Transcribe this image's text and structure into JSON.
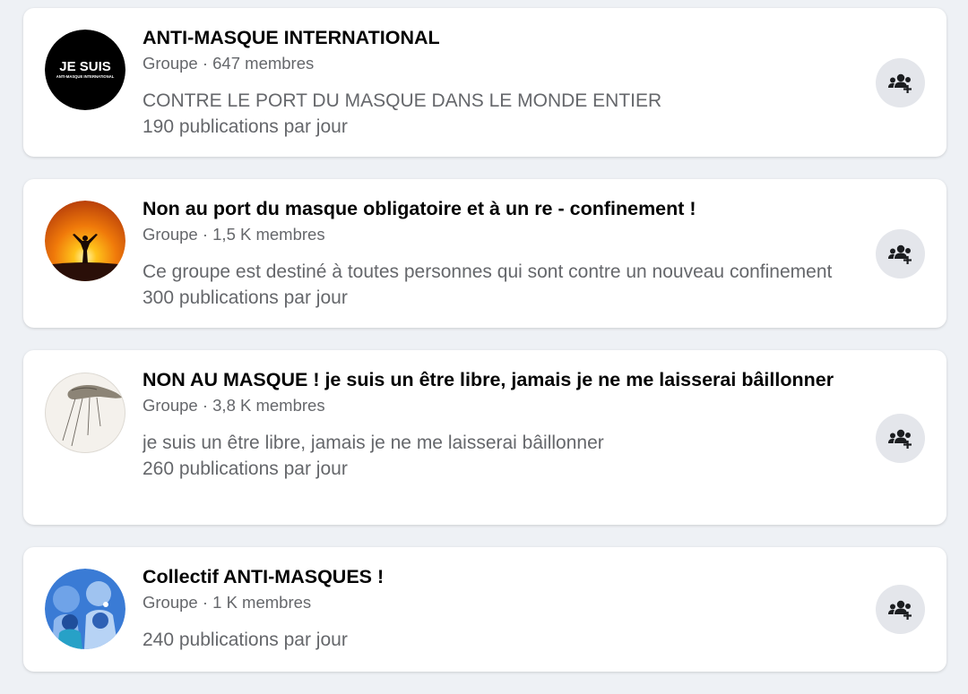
{
  "groups": [
    {
      "name": "ANTI-MASQUE INTERNATIONAL",
      "meta": "Groupe · 647 membres",
      "description": "CONTRE LE PORT DU MASQUE DANS LE MONDE ENTIER",
      "posts": "190 publications par jour",
      "avatar_icon": "je-suis-logo",
      "avatar_text_main": "JE SUIS",
      "avatar_text_sub": "ANTI-MASQUE INTERNATIONAL"
    },
    {
      "name": "Non au port du masque obligatoire et à un re - confinement !",
      "meta": "Groupe · 1,5 K membres",
      "description": "Ce groupe est destiné à toutes personnes qui sont contre un nouveau confinement",
      "posts": "300 publications par jour",
      "avatar_icon": "sunset-silhouette"
    },
    {
      "name": "NON AU MASQUE ! je suis un être libre, jamais je ne me laisserai bâillonner",
      "meta": "Groupe · 3,8 K membres",
      "description": "je suis un être libre, jamais je ne me laisserai bâillonner",
      "posts": "260 publications par jour",
      "avatar_icon": "puppet-hand"
    },
    {
      "name": "Collectif ANTI-MASQUES !",
      "meta": "Groupe · 1 K membres",
      "description": "",
      "posts": "240 publications par jour",
      "avatar_icon": "group-illustration"
    }
  ],
  "join_icon": "join-group-icon",
  "colors": {
    "background": "#eef1f5",
    "card": "#ffffff",
    "title": "#050505",
    "secondary": "#65676b",
    "button": "#e4e6eb"
  }
}
